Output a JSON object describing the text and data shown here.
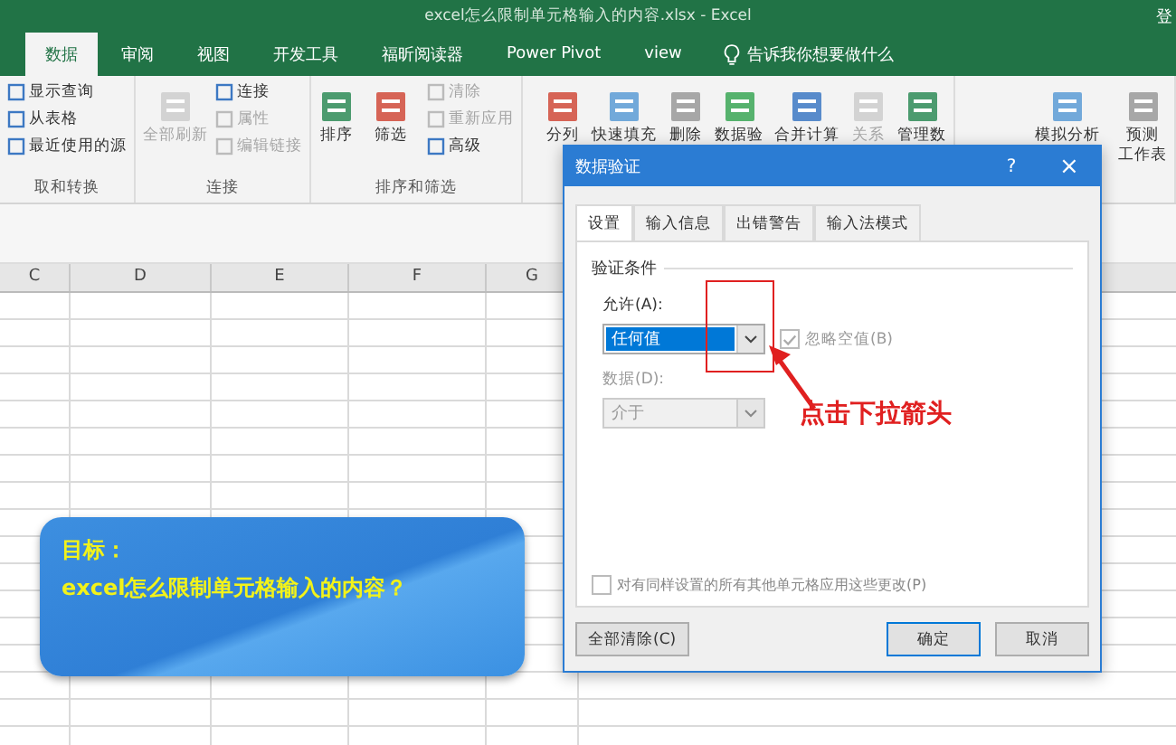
{
  "window": {
    "title": "excel怎么限制单元格输入的内容.xlsx - Excel",
    "account": "登"
  },
  "tabs": [
    {
      "label": "数据",
      "selected": true
    },
    {
      "label": "审阅",
      "selected": false
    },
    {
      "label": "视图",
      "selected": false
    },
    {
      "label": "开发工具",
      "selected": false
    },
    {
      "label": "福昕阅读器",
      "selected": false
    },
    {
      "label": "Power Pivot",
      "selected": false
    },
    {
      "label": "view",
      "selected": false
    }
  ],
  "tell_me": "告诉我你想要做什么",
  "ribbon": [
    {
      "label": "取和转换",
      "small": [
        {
          "label": "显示查询",
          "disabled": false
        },
        {
          "label": "从表格",
          "disabled": false
        },
        {
          "label": "最近使用的源",
          "disabled": false
        }
      ]
    },
    {
      "label": "连接",
      "big": [
        {
          "label": "全部刷新",
          "disabled": true
        }
      ],
      "small": [
        {
          "label": "连接",
          "disabled": false
        },
        {
          "label": "属性",
          "disabled": true
        },
        {
          "label": "编辑链接",
          "disabled": true
        }
      ]
    },
    {
      "label": "排序和筛选",
      "big": [
        {
          "label": "排序",
          "disabled": false
        },
        {
          "label": "筛选",
          "disabled": false
        }
      ],
      "small": [
        {
          "label": "清除",
          "disabled": true
        },
        {
          "label": "重新应用",
          "disabled": true
        },
        {
          "label": "高级",
          "disabled": false
        }
      ]
    },
    {
      "big": [
        {
          "label": "分列",
          "disabled": false
        },
        {
          "label": "快速填充",
          "disabled": false
        },
        {
          "label": "删除",
          "disabled": false
        },
        {
          "label": "数据验",
          "disabled": false
        },
        {
          "label": "合并计算",
          "disabled": false
        },
        {
          "label": "关系",
          "disabled": true
        },
        {
          "label": "管理数",
          "disabled": false
        }
      ]
    },
    {
      "big": [
        {
          "label": "模拟分析",
          "disabled": false
        },
        {
          "label": "预测",
          "label_2": "工作表",
          "disabled": false
        }
      ]
    }
  ],
  "columns": [
    "C",
    "D",
    "E",
    "F",
    "G"
  ],
  "dialog": {
    "title": "数据验证",
    "help": "?",
    "close": "×",
    "tabs": [
      {
        "label": "设置",
        "selected": true
      },
      {
        "label": "输入信息",
        "selected": false
      },
      {
        "label": "出错警告",
        "selected": false
      },
      {
        "label": "输入法模式",
        "selected": false
      }
    ],
    "section": "验证条件",
    "allow_label": "允许(A):",
    "allow_value": "任何值",
    "allow_selected": true,
    "ignore_blank": {
      "label": "忽略空值(B)",
      "checked": true,
      "disabled": true
    },
    "data_label": "数据(D):",
    "data_value": "介于",
    "data_disabled": true,
    "apply_all": {
      "label": "对有同样设置的所有其他单元格应用这些更改(P)",
      "checked": false
    },
    "buttons": [
      {
        "label": "全部清除(C)",
        "kind": "left"
      },
      {
        "label": "确定",
        "kind": "default"
      },
      {
        "label": "取消",
        "kind": "normal"
      }
    ]
  },
  "annotation": "点击下拉箭头",
  "callout": {
    "heading": "目标：",
    "text": "excel怎么限制单元格输入的内容？"
  }
}
